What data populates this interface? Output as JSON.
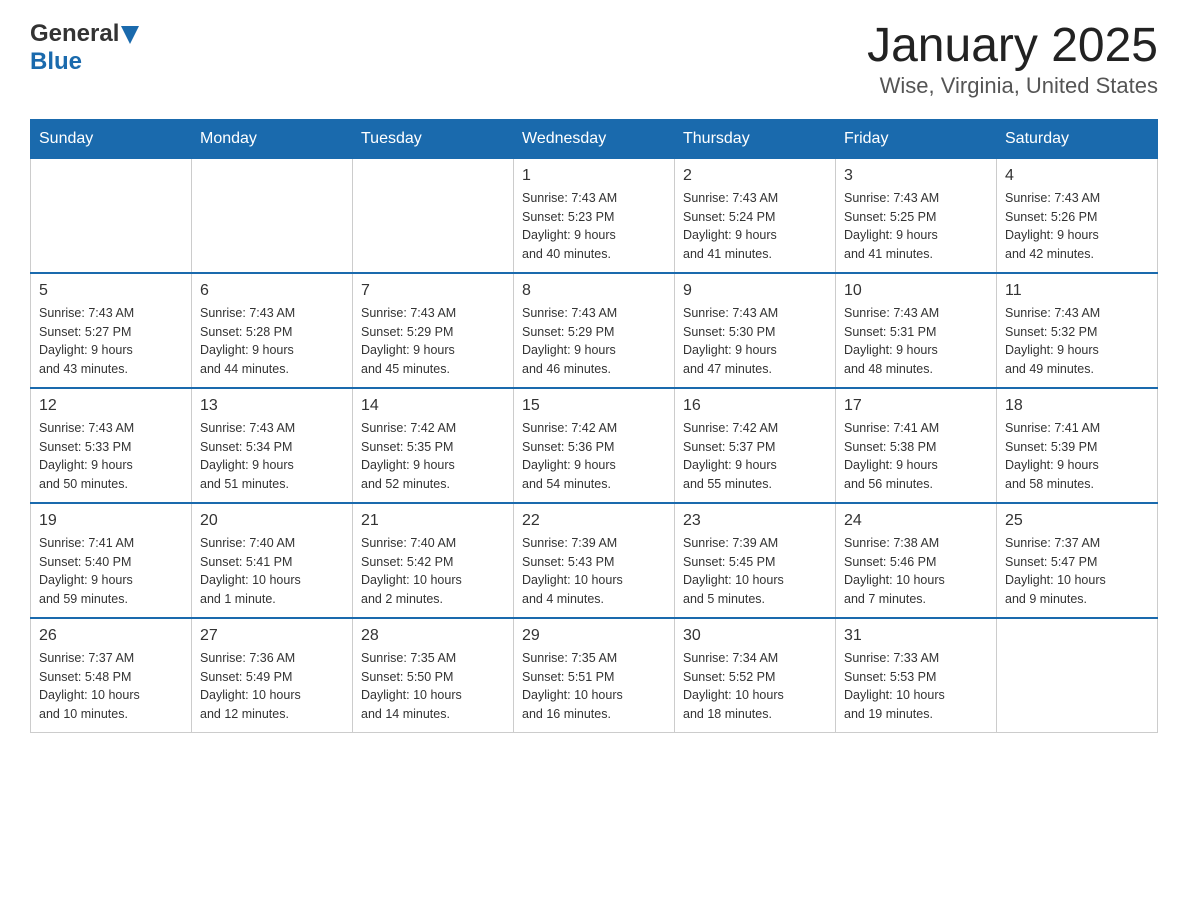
{
  "header": {
    "logo_general": "General",
    "logo_blue": "Blue",
    "month_title": "January 2025",
    "location": "Wise, Virginia, United States"
  },
  "days_of_week": [
    "Sunday",
    "Monday",
    "Tuesday",
    "Wednesday",
    "Thursday",
    "Friday",
    "Saturday"
  ],
  "weeks": [
    [
      {
        "day": "",
        "info": ""
      },
      {
        "day": "",
        "info": ""
      },
      {
        "day": "",
        "info": ""
      },
      {
        "day": "1",
        "info": "Sunrise: 7:43 AM\nSunset: 5:23 PM\nDaylight: 9 hours\nand 40 minutes."
      },
      {
        "day": "2",
        "info": "Sunrise: 7:43 AM\nSunset: 5:24 PM\nDaylight: 9 hours\nand 41 minutes."
      },
      {
        "day": "3",
        "info": "Sunrise: 7:43 AM\nSunset: 5:25 PM\nDaylight: 9 hours\nand 41 minutes."
      },
      {
        "day": "4",
        "info": "Sunrise: 7:43 AM\nSunset: 5:26 PM\nDaylight: 9 hours\nand 42 minutes."
      }
    ],
    [
      {
        "day": "5",
        "info": "Sunrise: 7:43 AM\nSunset: 5:27 PM\nDaylight: 9 hours\nand 43 minutes."
      },
      {
        "day": "6",
        "info": "Sunrise: 7:43 AM\nSunset: 5:28 PM\nDaylight: 9 hours\nand 44 minutes."
      },
      {
        "day": "7",
        "info": "Sunrise: 7:43 AM\nSunset: 5:29 PM\nDaylight: 9 hours\nand 45 minutes."
      },
      {
        "day": "8",
        "info": "Sunrise: 7:43 AM\nSunset: 5:29 PM\nDaylight: 9 hours\nand 46 minutes."
      },
      {
        "day": "9",
        "info": "Sunrise: 7:43 AM\nSunset: 5:30 PM\nDaylight: 9 hours\nand 47 minutes."
      },
      {
        "day": "10",
        "info": "Sunrise: 7:43 AM\nSunset: 5:31 PM\nDaylight: 9 hours\nand 48 minutes."
      },
      {
        "day": "11",
        "info": "Sunrise: 7:43 AM\nSunset: 5:32 PM\nDaylight: 9 hours\nand 49 minutes."
      }
    ],
    [
      {
        "day": "12",
        "info": "Sunrise: 7:43 AM\nSunset: 5:33 PM\nDaylight: 9 hours\nand 50 minutes."
      },
      {
        "day": "13",
        "info": "Sunrise: 7:43 AM\nSunset: 5:34 PM\nDaylight: 9 hours\nand 51 minutes."
      },
      {
        "day": "14",
        "info": "Sunrise: 7:42 AM\nSunset: 5:35 PM\nDaylight: 9 hours\nand 52 minutes."
      },
      {
        "day": "15",
        "info": "Sunrise: 7:42 AM\nSunset: 5:36 PM\nDaylight: 9 hours\nand 54 minutes."
      },
      {
        "day": "16",
        "info": "Sunrise: 7:42 AM\nSunset: 5:37 PM\nDaylight: 9 hours\nand 55 minutes."
      },
      {
        "day": "17",
        "info": "Sunrise: 7:41 AM\nSunset: 5:38 PM\nDaylight: 9 hours\nand 56 minutes."
      },
      {
        "day": "18",
        "info": "Sunrise: 7:41 AM\nSunset: 5:39 PM\nDaylight: 9 hours\nand 58 minutes."
      }
    ],
    [
      {
        "day": "19",
        "info": "Sunrise: 7:41 AM\nSunset: 5:40 PM\nDaylight: 9 hours\nand 59 minutes."
      },
      {
        "day": "20",
        "info": "Sunrise: 7:40 AM\nSunset: 5:41 PM\nDaylight: 10 hours\nand 1 minute."
      },
      {
        "day": "21",
        "info": "Sunrise: 7:40 AM\nSunset: 5:42 PM\nDaylight: 10 hours\nand 2 minutes."
      },
      {
        "day": "22",
        "info": "Sunrise: 7:39 AM\nSunset: 5:43 PM\nDaylight: 10 hours\nand 4 minutes."
      },
      {
        "day": "23",
        "info": "Sunrise: 7:39 AM\nSunset: 5:45 PM\nDaylight: 10 hours\nand 5 minutes."
      },
      {
        "day": "24",
        "info": "Sunrise: 7:38 AM\nSunset: 5:46 PM\nDaylight: 10 hours\nand 7 minutes."
      },
      {
        "day": "25",
        "info": "Sunrise: 7:37 AM\nSunset: 5:47 PM\nDaylight: 10 hours\nand 9 minutes."
      }
    ],
    [
      {
        "day": "26",
        "info": "Sunrise: 7:37 AM\nSunset: 5:48 PM\nDaylight: 10 hours\nand 10 minutes."
      },
      {
        "day": "27",
        "info": "Sunrise: 7:36 AM\nSunset: 5:49 PM\nDaylight: 10 hours\nand 12 minutes."
      },
      {
        "day": "28",
        "info": "Sunrise: 7:35 AM\nSunset: 5:50 PM\nDaylight: 10 hours\nand 14 minutes."
      },
      {
        "day": "29",
        "info": "Sunrise: 7:35 AM\nSunset: 5:51 PM\nDaylight: 10 hours\nand 16 minutes."
      },
      {
        "day": "30",
        "info": "Sunrise: 7:34 AM\nSunset: 5:52 PM\nDaylight: 10 hours\nand 18 minutes."
      },
      {
        "day": "31",
        "info": "Sunrise: 7:33 AM\nSunset: 5:53 PM\nDaylight: 10 hours\nand 19 minutes."
      },
      {
        "day": "",
        "info": ""
      }
    ]
  ]
}
